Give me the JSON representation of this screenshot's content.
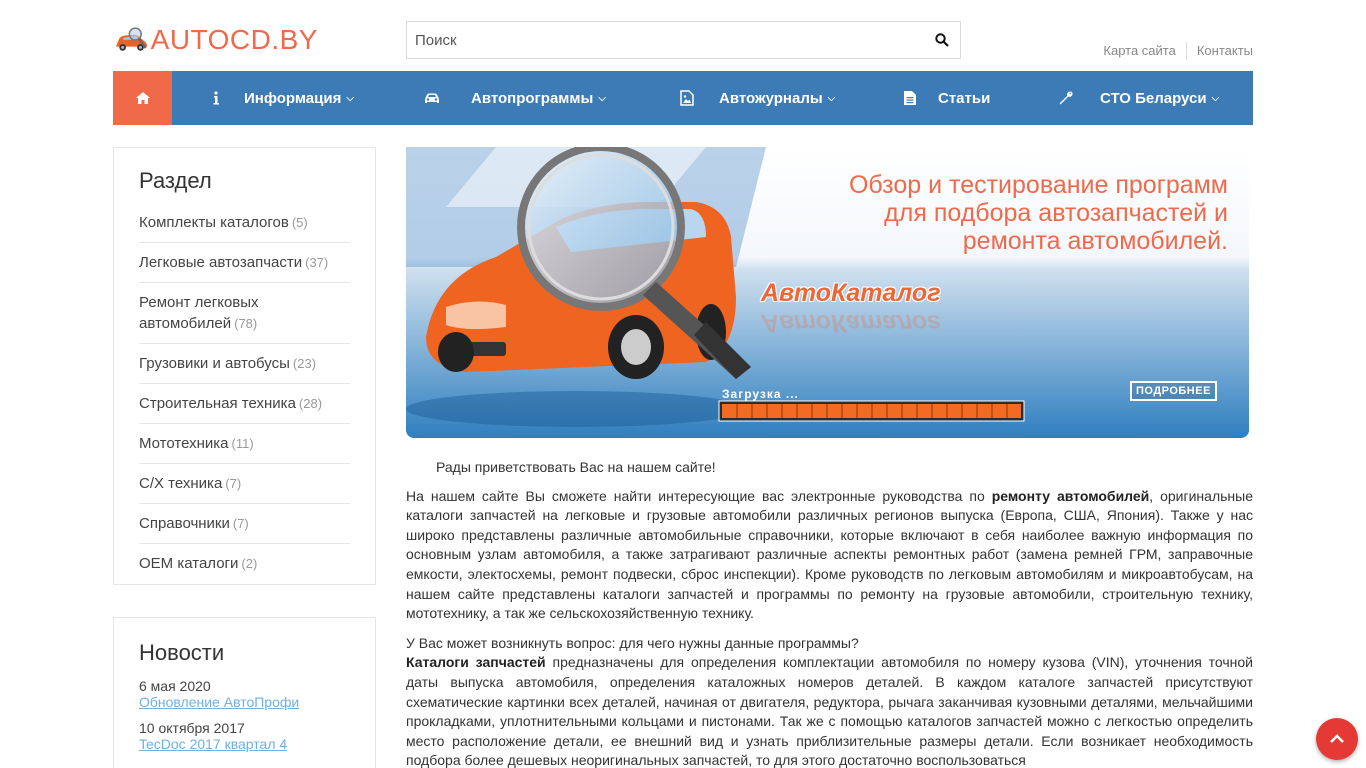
{
  "header": {
    "logo_text": "AUTOCD.BY",
    "search_placeholder": "Поиск",
    "links": [
      "Карта сайта",
      "Контакты"
    ]
  },
  "nav": {
    "items": [
      {
        "label": "Информация",
        "icon": "info-icon",
        "dropdown": true
      },
      {
        "label": "Автопрограммы",
        "icon": "car-icon",
        "dropdown": true
      },
      {
        "label": "Автожурналы",
        "icon": "image-file-icon",
        "dropdown": true
      },
      {
        "label": "Статьи",
        "icon": "document-icon",
        "dropdown": false
      },
      {
        "label": "СТО Беларуси",
        "icon": "wrench-icon",
        "dropdown": true
      }
    ],
    "colors": {
      "bar": "#3c7bb5",
      "home": "#f06a4a"
    }
  },
  "sidebar": {
    "title": "Раздел",
    "items": [
      {
        "label": "Комплекты каталогов",
        "count": "(5)"
      },
      {
        "label": "Легковые автозапчасти",
        "count": "(37)"
      },
      {
        "label": "Ремонт легковых автомобилей",
        "count": "(78)"
      },
      {
        "label": "Грузовики и автобусы",
        "count": "(23)"
      },
      {
        "label": "Строительная техника",
        "count": "(28)"
      },
      {
        "label": "Мототехника",
        "count": "(11)"
      },
      {
        "label": "С/Х техника",
        "count": "(7)"
      },
      {
        "label": "Справочники",
        "count": "(7)"
      },
      {
        "label": "OEM каталоги",
        "count": "(2)"
      }
    ]
  },
  "news": {
    "title": "Новости",
    "items": [
      {
        "date": "6 мая 2020",
        "link": "Обновление АвтоПрофи"
      },
      {
        "date": "10 октября 2017",
        "link": "TecDoc 2017 квартал 4"
      }
    ]
  },
  "banner": {
    "heading_lines": [
      "Обзор и тестирование программ",
      "для подбора автозапчастей и",
      "ремонта автомобилей."
    ],
    "brand": "АвтоКаталог",
    "loading": "Загрузка ...",
    "more": "ПОДРОБНЕЕ"
  },
  "content": {
    "welcome": "Рады приветствовать Вас на нашем сайте!",
    "p1_a": "На нашем сайте Вы сможете найти интересующие вас электронные руководства по ",
    "p1_b": "ремонту автомобилей",
    "p1_c": ", оригинальные каталоги  запчастей на легковые и грузовые автомобили различных регионов выпуска (Европа, США, Япония). Также у нас широко представлены различные автомобильные справочники, которые включают в себя наиболее важную информация по основным узлам автомобиля, а также затрагивают различные аспекты ремонтных работ (замена ремней ГРМ, заправочные емкости, электосхемы, ремонт подвески, сброс инспекции). Кроме руководств по легковым автомобилям и микроавтобусам, на нашем сайте представлены каталоги запчастей и программы по ремонту на грузовые автомобили, строительную технику, мототехнику, а так же сельскохозяйственную технику.",
    "p2": "У Вас может возникнуть вопрос: для чего нужны данные программы?",
    "p3_a": "Каталоги запчастей",
    "p3_b": " предназначены для определения комплектации автомобиля по номеру кузова (VIN), уточнения точной даты выпуска автомобиля, определения каталожных номеров деталей. В каждом каталоге запчастей присутствуют схематические картинки всех деталей, начиная от двигателя, редуктора, рычага заканчивая кузовными деталями, мельчайшими прокладками, уплотнительными кольцами и пистонами. Так же с помощью каталогов запчастей можно с легкостью определить место расположение детали, ее внешний вид и узнать приблизительные размеры детали. Если возникает необходимость подбора более дешевых неоригинальных запчастей, то для этого достаточно воспользоваться"
  }
}
